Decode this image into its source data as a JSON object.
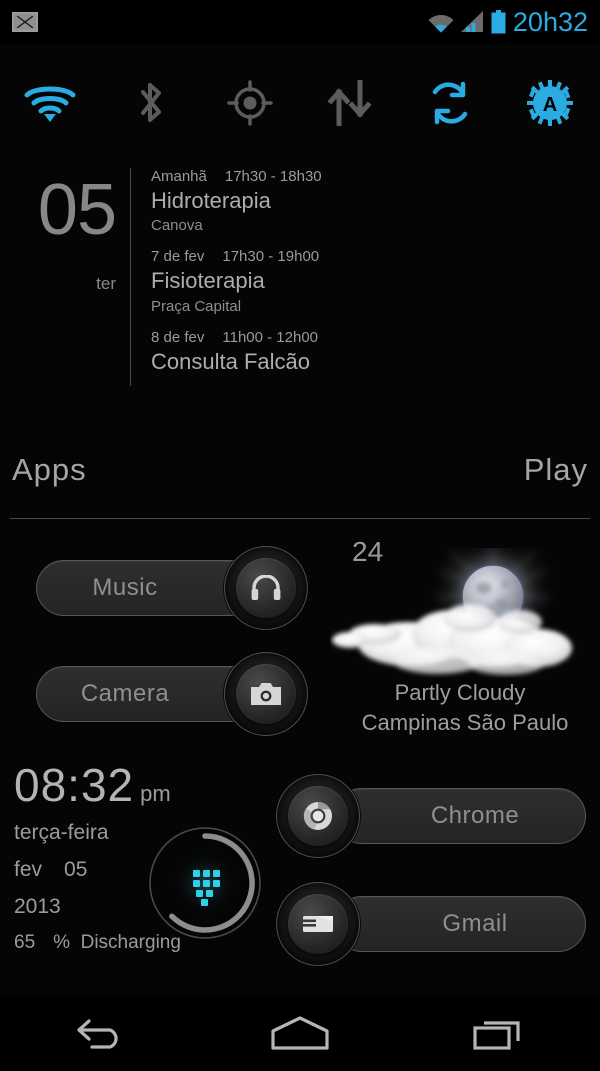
{
  "statusbar": {
    "notification_icon": "gmail-icon",
    "wifi_icon": "wifi-icon",
    "signal_icon": "cell-signal-icon",
    "battery_icon": "battery-icon",
    "time": "20h32",
    "accent_color": "#2aabe2"
  },
  "toggles": [
    {
      "name": "wifi-toggle",
      "icon": "wifi-icon",
      "active": true
    },
    {
      "name": "bluetooth-toggle",
      "icon": "bluetooth-icon",
      "active": false
    },
    {
      "name": "gps-toggle",
      "icon": "location-icon",
      "active": false
    },
    {
      "name": "data-toggle",
      "icon": "data-transfer-icon",
      "active": false
    },
    {
      "name": "sync-toggle",
      "icon": "sync-icon",
      "active": true
    },
    {
      "name": "autobrightness-toggle",
      "icon": "auto-brightness-icon",
      "active": true
    }
  ],
  "calendar": {
    "day_number": "05",
    "day_of_week": "ter",
    "events": [
      {
        "date": "Amanhã",
        "time": "17h30 - 18h30",
        "title": "Hidroterapia",
        "location": "Canova"
      },
      {
        "date": "7 de fev",
        "time": "17h30 - 19h00",
        "title": "Fisioterapia",
        "location": "Praça Capital"
      },
      {
        "date": "8 de fev",
        "time": "11h00 - 12h00",
        "title": "Consulta Falcão",
        "location": ""
      }
    ]
  },
  "apps_row": {
    "left_label": "Apps",
    "right_label": "Play"
  },
  "shortcuts": [
    {
      "name": "music-shortcut",
      "label": "Music",
      "icon": "headphones-icon",
      "side": "right"
    },
    {
      "name": "camera-shortcut",
      "label": "Camera",
      "icon": "camera-icon",
      "side": "right"
    },
    {
      "name": "chrome-shortcut",
      "label": "Chrome",
      "icon": "chrome-icon",
      "side": "left"
    },
    {
      "name": "gmail-shortcut",
      "label": "Gmail",
      "icon": "gmail-icon",
      "side": "left"
    }
  ],
  "weather": {
    "temperature": "24",
    "condition": "Partly Cloudy",
    "location": "Campinas São Paulo",
    "art_icon": "moon-behind-clouds-icon"
  },
  "clock": {
    "time": "08:32",
    "ampm": "pm",
    "weekday": "terça-feira",
    "month": "fev",
    "day": "05",
    "year": "2013",
    "battery_percent": "65",
    "percent_symbol": "%",
    "battery_state": "Discharging"
  },
  "app_drawer": {
    "name": "app-drawer-button",
    "icon": "app-grid-icon",
    "ring_fill_percent": "65",
    "glow_color": "#2fd0e8"
  },
  "navbar": [
    {
      "name": "nav-back-button",
      "icon": "back-arrow-icon"
    },
    {
      "name": "nav-home-button",
      "icon": "home-icon"
    },
    {
      "name": "nav-recents-button",
      "icon": "recents-icon"
    }
  ]
}
